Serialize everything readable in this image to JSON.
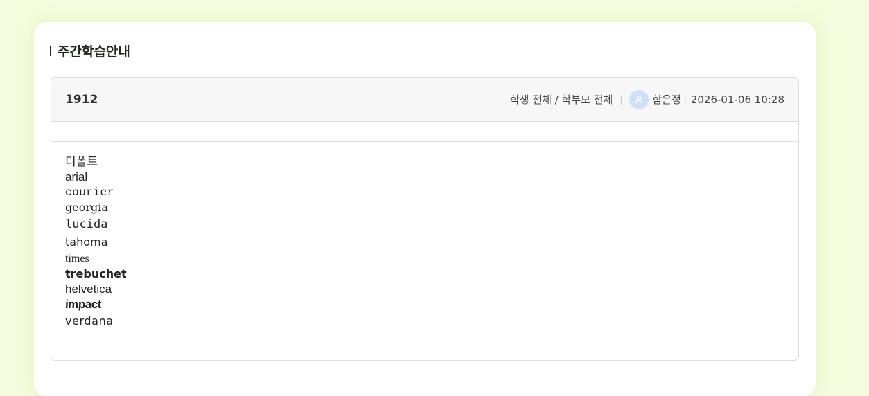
{
  "section": {
    "title": "주간학습안내"
  },
  "post": {
    "title": "1912",
    "audience": "학생 전체 / 학부모 전체",
    "author": "함은정",
    "datetime": "2026-01-06 10:28",
    "separator": "|",
    "avatar_icon": "user-icon",
    "avatar_color": "#cfe0fb"
  },
  "body": {
    "font_samples": [
      "디폴트",
      "arial",
      "courier",
      "georgia",
      "lucida",
      "tahoma",
      "times",
      "trebuchet",
      "helvetica",
      "impact",
      "verdana"
    ]
  },
  "colors": {
    "page_background": "#f3fcdc",
    "card_background": "#ffffff",
    "header_background": "#f7f7f7",
    "border": "#dcdcdc"
  }
}
